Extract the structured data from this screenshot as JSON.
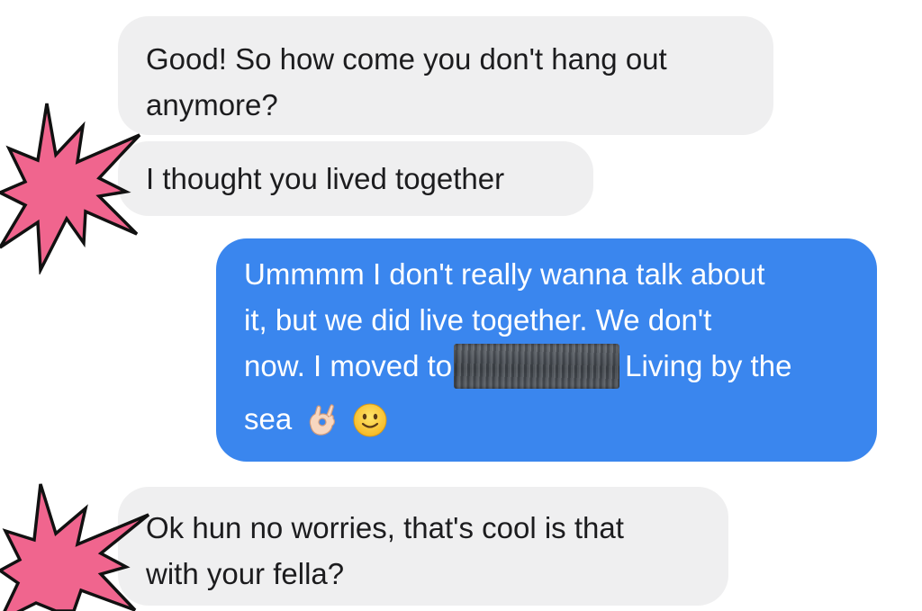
{
  "conversation": {
    "messages": [
      {
        "direction": "incoming",
        "lines": [
          "Good! So how come you don't hang out",
          "anymore?"
        ]
      },
      {
        "direction": "incoming",
        "lines": [
          "I thought you lived together"
        ]
      },
      {
        "direction": "outgoing",
        "lines": [
          "Ummmm I don't really wanna talk about",
          "it, but we did live together. We don't",
          "now. I moved to",
          "Living by the",
          "sea"
        ],
        "emojis": [
          "ok-hand-emoji",
          "slightly-smiling-face-emoji"
        ]
      },
      {
        "direction": "incoming",
        "lines": [
          "Ok hun no worries, that's cool is that",
          "with your fella?"
        ]
      }
    ]
  },
  "decorations": {
    "burst_color": "#f0658e",
    "burst_outline": "#111111"
  },
  "colors": {
    "incoming_bubble": "#efeff0",
    "outgoing_bubble": "#3a86ee",
    "incoming_text": "#1c1c1e",
    "outgoing_text": "#ffffff"
  }
}
